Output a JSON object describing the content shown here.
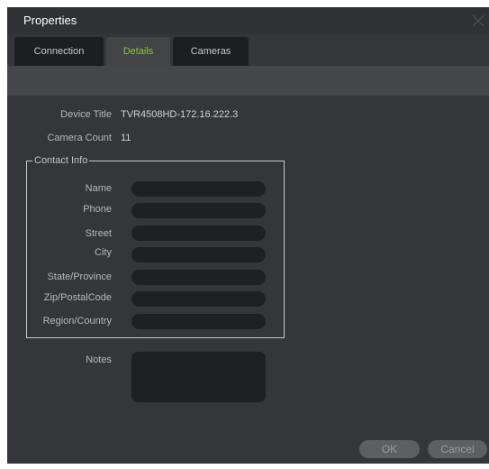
{
  "window": {
    "title": "Properties"
  },
  "tabs": [
    {
      "label": "Connection"
    },
    {
      "label": "Details"
    },
    {
      "label": "Cameras"
    }
  ],
  "active_tab": "Details",
  "device": {
    "title_label": "Device Title",
    "title_value": "TVR4508HD-172.16.222.3",
    "count_label": "Camera Count",
    "count_value": "11"
  },
  "contact": {
    "legend": "Contact Info",
    "fields": [
      {
        "label": "Name",
        "value": ""
      },
      {
        "label": "Phone",
        "value": ""
      },
      {
        "label": "Street",
        "value": ""
      },
      {
        "label": "City",
        "value": ""
      },
      {
        "label": "State/Province",
        "value": ""
      },
      {
        "label": "Zip/PostalCode",
        "value": ""
      },
      {
        "label": "Region/Country",
        "value": ""
      }
    ]
  },
  "notes": {
    "label": "Notes",
    "value": ""
  },
  "buttons": {
    "ok": "OK",
    "cancel": "Cancel"
  },
  "colors": {
    "dialog_bg": "#343639",
    "tab_inactive": "#1d1e20",
    "tab_active": "#424448",
    "tab_active_text": "#8cc43b",
    "field_bg": "#1f2022",
    "button_bg": "#5d5f62"
  },
  "icons": {
    "close": "close-icon"
  }
}
